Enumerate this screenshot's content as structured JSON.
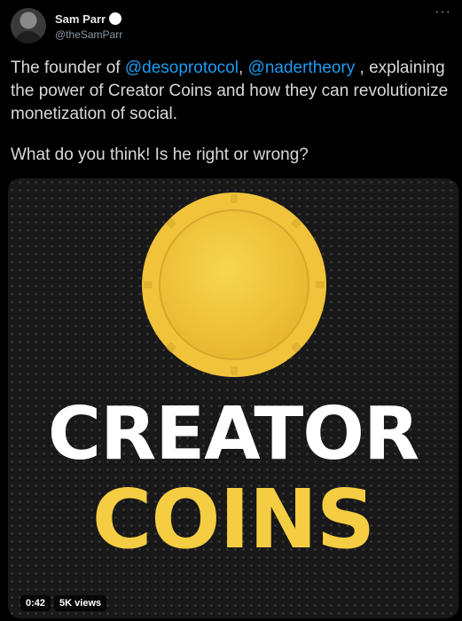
{
  "author": {
    "display_name": "Sam Parr",
    "handle": "@theSamParr",
    "verified_icon": "verified-badge-icon"
  },
  "menu": {
    "more_icon": "more-horizontal-icon",
    "more_glyph": "···"
  },
  "tweet": {
    "line1_pre": "The founder of ",
    "mention1": "@desoprotocol",
    "line1_mid": ", ",
    "mention2": "@nadertheory",
    "line1_post": " , explaining the power of Creator Coins and how they can revolutionize monetization of social.",
    "line2": "What do you think! Is he right or wrong?"
  },
  "media": {
    "word1": "CREATOR",
    "word2": "COINS",
    "duration": "0:42",
    "views": "5K views",
    "colors": {
      "coin_gold": "#f2ca3f",
      "coin_rim": "#e7b933",
      "text_white": "#ffffff",
      "text_gold": "#f4cd43"
    }
  },
  "colors": {
    "background": "#000000",
    "link": "#1d9bf0",
    "text": "#d9d9d9",
    "secondary": "#8b98a5"
  }
}
